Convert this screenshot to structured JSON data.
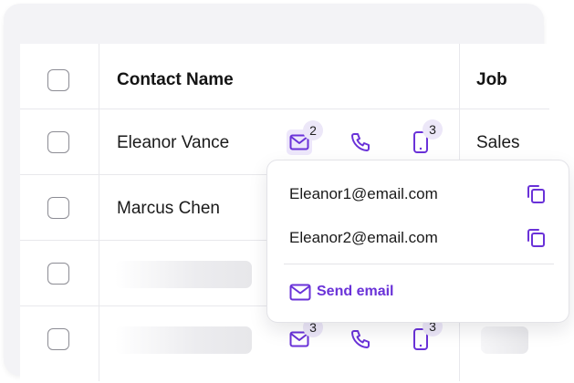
{
  "colors": {
    "accent": "#6a32d8",
    "badge_bg": "#ece7f8",
    "border": "#e8e8ec"
  },
  "table": {
    "headers": {
      "name": "Contact Name",
      "job": "Job"
    },
    "rows": [
      {
        "name": "Eleanor Vance",
        "job": "Sales",
        "email_count": "2",
        "phone_count": "3"
      },
      {
        "name": "Marcus Chen"
      },
      {
        "name": ""
      },
      {
        "name": "",
        "email_count": "3",
        "phone_count": "3"
      }
    ]
  },
  "popover": {
    "emails": [
      "Eleanor1@email.com",
      "Eleanor2@email.com"
    ],
    "send_label": "Send email"
  },
  "icons": {
    "email": "mail-icon",
    "call": "phone-icon",
    "mobile": "mobile-icon",
    "copy": "copy-icon"
  }
}
